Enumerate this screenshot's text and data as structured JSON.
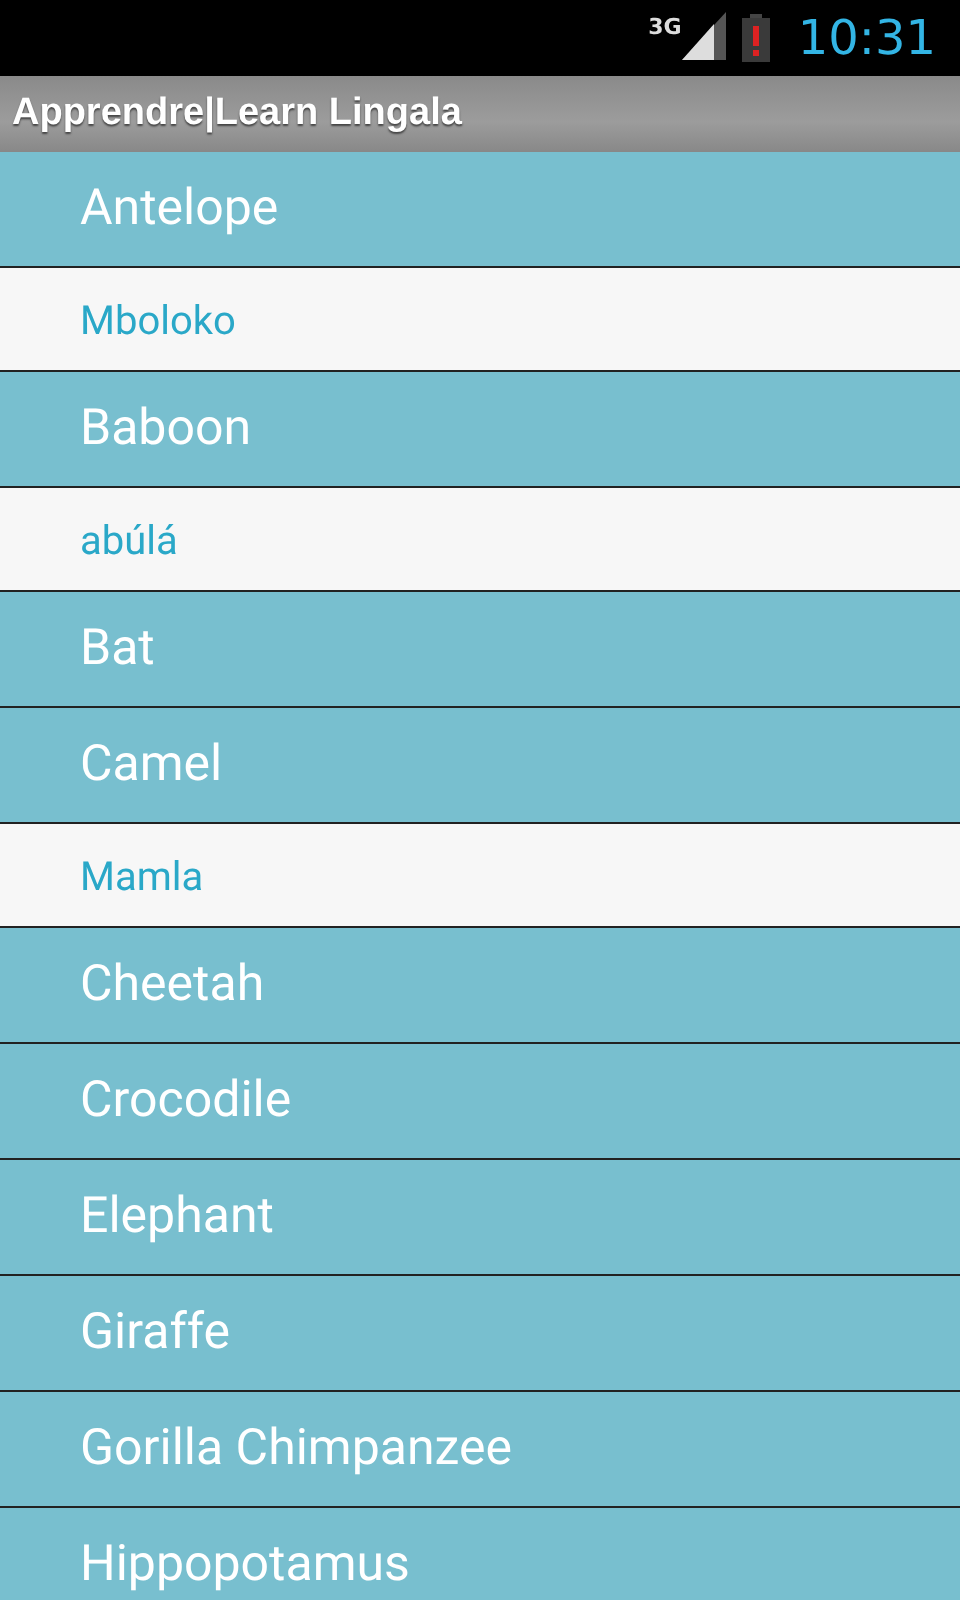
{
  "status_bar": {
    "network": "3G",
    "time": "10:31"
  },
  "title_bar": {
    "title": "Apprendre|Learn Lingala"
  },
  "list": [
    {
      "kind": "word",
      "label": "Antelope"
    },
    {
      "kind": "translation",
      "label": "Mboloko"
    },
    {
      "kind": "word",
      "label": "Baboon"
    },
    {
      "kind": "translation",
      "label": "abúlá"
    },
    {
      "kind": "word",
      "label": "Bat"
    },
    {
      "kind": "word",
      "label": "Camel"
    },
    {
      "kind": "translation",
      "label": "Mamla"
    },
    {
      "kind": "word",
      "label": "Cheetah"
    },
    {
      "kind": "word",
      "label": "Crocodile"
    },
    {
      "kind": "word",
      "label": "Elephant"
    },
    {
      "kind": "word",
      "label": "Giraffe"
    },
    {
      "kind": "word",
      "label": "Gorilla Chimpanzee"
    },
    {
      "kind": "word",
      "label": "Hippopotamus"
    }
  ]
}
